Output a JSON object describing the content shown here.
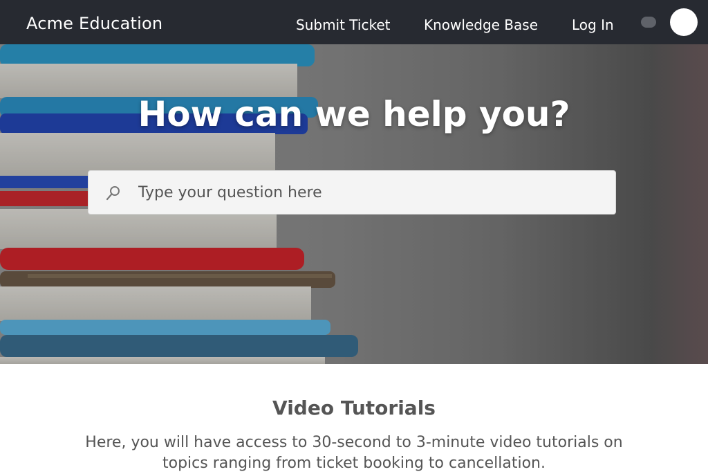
{
  "header": {
    "brand": "Acme Education",
    "nav": {
      "submit_ticket": "Submit Ticket",
      "knowledge_base": "Knowledge Base",
      "log_in": "Log In"
    },
    "background_color": "#272a31"
  },
  "hero": {
    "title": "How can we help you?",
    "search": {
      "placeholder": "Type your question here",
      "value": "",
      "icon": "search-icon"
    }
  },
  "section": {
    "title": "Video Tutorials",
    "description": "Here, you will have access to 30-second to 3-minute video tutorials on topics ranging from ticket booking to cancellation."
  },
  "colors": {
    "text_muted": "#555555",
    "hero_text": "#ffffff"
  }
}
